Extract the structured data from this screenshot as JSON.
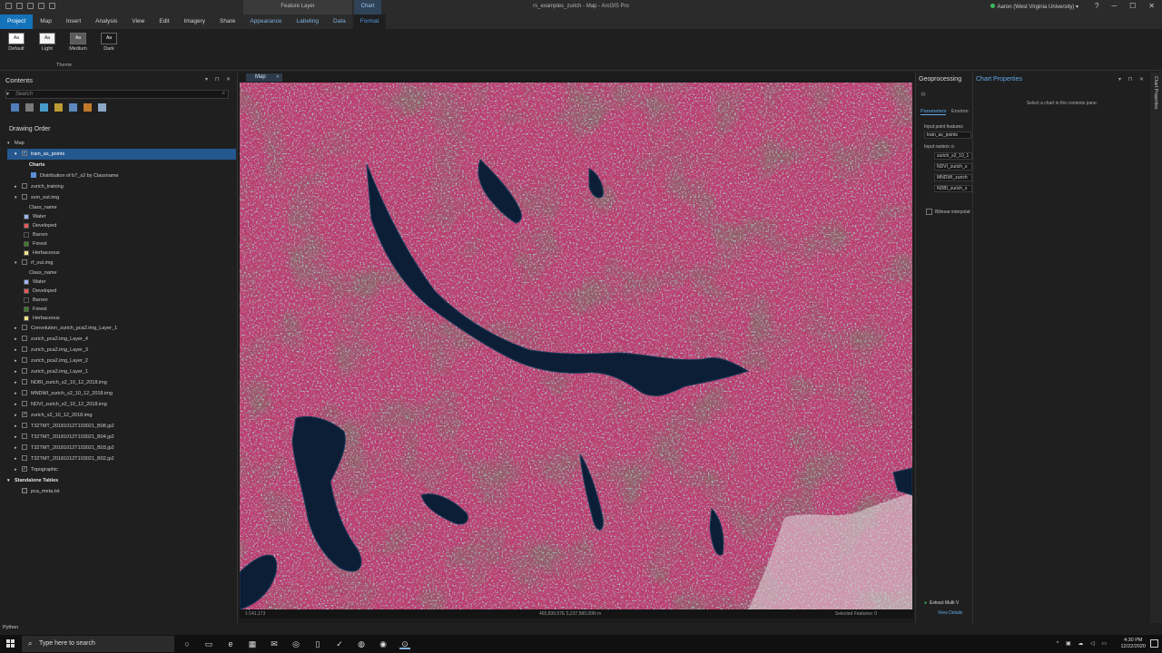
{
  "window": {
    "title": "rs_examples_zurich - Map - ArcGIS Pro",
    "contextual_groups": {
      "feature_layer": "Feature Layer",
      "chart": "Chart"
    },
    "user": "Aaron (West Virginia University) ▾",
    "controls": {
      "help": "?",
      "minimize": "─",
      "maximize": "☐",
      "close": "✕"
    }
  },
  "ribbon": {
    "tabs": [
      "Project",
      "Map",
      "Insert",
      "Analysis",
      "View",
      "Edit",
      "Imagery",
      "Share",
      "Appearance",
      "Labeling",
      "Data",
      "Format"
    ],
    "themes": [
      {
        "label": "Default",
        "swatch": "Aa",
        "bg": "#ffffff",
        "fg": "#222222"
      },
      {
        "label": "Light",
        "swatch": "Aa",
        "bg": "#f4f4f4",
        "fg": "#222222"
      },
      {
        "label": "Medium",
        "swatch": "Aa",
        "bg": "#5a5a5a",
        "fg": "#eeeeee"
      },
      {
        "label": "Dark",
        "swatch": "Aa",
        "bg": "#1b1b1b",
        "fg": "#eeeeee"
      }
    ],
    "group_label": "Theme"
  },
  "contents": {
    "title": "Contents",
    "pane_controls": "▾ ⊓ ✕",
    "search_placeholder": "Search",
    "search_icon": "⌕",
    "drawing_order": "Drawing Order",
    "tool_colors": [
      "#5b8fd6",
      "#8a8a8a",
      "#4fb1e8",
      "#d9b23b",
      "#6a9bd8",
      "#e08a2e",
      "#9fbfe6"
    ],
    "items": [
      {
        "level": 0,
        "expand": "▾",
        "check": "",
        "label": "Map"
      },
      {
        "level": 1,
        "expand": "▾",
        "check": "✓",
        "label": "train_as_points",
        "selected": true
      },
      {
        "level": 2,
        "expand": "",
        "check": "",
        "label": "Charts",
        "bold": true
      },
      {
        "level": 3,
        "expand": "",
        "check": "",
        "label": "Distribution of b7_s2 by Classname"
      },
      {
        "level": 1,
        "expand": "▸",
        "check": "☐",
        "label": "zurich_training"
      },
      {
        "level": 1,
        "expand": "▾",
        "check": "☐",
        "label": "svm_out.img"
      },
      {
        "level": 2,
        "label": "Class_name",
        "type": "legend-head"
      },
      {
        "level": 2,
        "label": "Water",
        "type": "legend",
        "color": "#9bb6f0"
      },
      {
        "level": 2,
        "label": "Developed",
        "type": "legend",
        "color": "#e85b5b"
      },
      {
        "level": 2,
        "label": "Barren",
        "type": "legend",
        "color": "#1e1e1e"
      },
      {
        "level": 2,
        "label": "Forest",
        "type": "legend",
        "color": "#3e7a2a"
      },
      {
        "level": 2,
        "label": "Herbaceous",
        "type": "legend",
        "color": "#eee48a"
      },
      {
        "level": 1,
        "expand": "▾",
        "check": "☐",
        "label": "rf_out.img"
      },
      {
        "level": 2,
        "label": "Class_name",
        "type": "legend-head"
      },
      {
        "level": 2,
        "label": "Water",
        "type": "legend",
        "color": "#9bb6f0"
      },
      {
        "level": 2,
        "label": "Developed",
        "type": "legend",
        "color": "#e85b5b"
      },
      {
        "level": 2,
        "label": "Barren",
        "type": "legend",
        "color": "#1e1e1e"
      },
      {
        "level": 2,
        "label": "Forest",
        "type": "legend",
        "color": "#3e7a2a"
      },
      {
        "level": 2,
        "label": "Herbaceous",
        "type": "legend",
        "color": "#eee48a"
      },
      {
        "level": 1,
        "expand": "▸",
        "check": "☐",
        "label": "Convolution_zurich_pca2.img_Layer_1"
      },
      {
        "level": 1,
        "expand": "▸",
        "check": "☐",
        "label": "zurich_pca2.img_Layer_4"
      },
      {
        "level": 1,
        "expand": "▸",
        "check": "☐",
        "label": "zurich_pca2.img_Layer_3"
      },
      {
        "level": 1,
        "expand": "▸",
        "check": "☐",
        "label": "zurich_pca2.img_Layer_2"
      },
      {
        "level": 1,
        "expand": "▸",
        "check": "☐",
        "label": "zurich_pca2.img_Layer_1"
      },
      {
        "level": 1,
        "expand": "▸",
        "check": "☐",
        "label": "NDBI_zurich_s2_10_12_2018.img"
      },
      {
        "level": 1,
        "expand": "▸",
        "check": "☐",
        "label": "MNDWI_zurich_s2_10_12_2018.img"
      },
      {
        "level": 1,
        "expand": "▸",
        "check": "☐",
        "label": "NDVI_zurich_s2_10_12_2018.img"
      },
      {
        "level": 1,
        "expand": "▸",
        "check": "✓",
        "label": "zurich_s2_10_12_2018.img"
      },
      {
        "level": 1,
        "expand": "▸",
        "check": "☐",
        "label": "T32TMT_20181012T103021_B08.jp2"
      },
      {
        "level": 1,
        "expand": "▸",
        "check": "☐",
        "label": "T32TMT_20181012T103021_B04.jp2"
      },
      {
        "level": 1,
        "expand": "▸",
        "check": "☐",
        "label": "T32TMT_20181012T103021_B03.jp2"
      },
      {
        "level": 1,
        "expand": "▸",
        "check": "☐",
        "label": "T32TMT_20181012T103021_B02.jp2"
      },
      {
        "level": 1,
        "expand": "▸",
        "check": "✓",
        "label": "Topographic"
      },
      {
        "level": 0,
        "expand": "▾",
        "check": "",
        "label": "Standalone Tables",
        "bold": true
      },
      {
        "level": 1,
        "expand": "",
        "check": "▤",
        "label": "pca_meta.txt"
      }
    ]
  },
  "map_view": {
    "tab_label": "Map",
    "tab_close": "✕",
    "scale": "1:141,173",
    "coordinates": "465,839.57E 5,237,580.00N m",
    "selected_features": "Selected Features: 0",
    "colors": {
      "vegetation": "#c44072",
      "forest": "#6e2a36",
      "water": "#0b1e36",
      "urban": "#5fb5b9",
      "snow": "#dcdcdc"
    }
  },
  "geoprocessing": {
    "title": "Geoprocessing",
    "back_icon": "⊖",
    "tabs": [
      "Parameters",
      "Environ"
    ],
    "input_features_label": "Input point features",
    "input_features_value": "train_as_points",
    "input_rasters_label": "Input rasters ⊙",
    "rasters": [
      "zurich_s2_10_1",
      "NDVI_zurich_s",
      "MNDWI_zurich",
      "NDBI_zurich_s"
    ],
    "bilinear": "Bilinear interpolat",
    "status": "Extract Multi V",
    "view_details": "View Details"
  },
  "chart_properties": {
    "title": "Chart Properties",
    "hint": "Select a chart in the contents pane.",
    "controls": "▾ ⊓ ✕",
    "side_tab": "Chart Properties"
  },
  "python_tab": "Python",
  "taskbar": {
    "search": "Type here to search",
    "icons": [
      "○",
      "▭",
      "e",
      "▦",
      "✉",
      "◎",
      "▯",
      "✓",
      "◍",
      "◉",
      "⊙"
    ],
    "tray": "^ ▣ ☁ ◁ ▭",
    "time": "4:30 PM",
    "date": "12/22/2020"
  }
}
